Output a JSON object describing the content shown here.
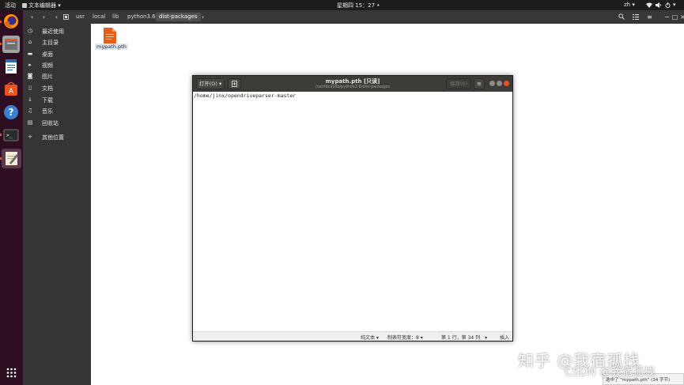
{
  "topbar": {
    "activities": "活动",
    "app_menu": "文本编辑器",
    "clock": "星期四 15：27",
    "lang": "zh"
  },
  "nautilus": {
    "path": [
      "usr",
      "local",
      "lib",
      "python3.6",
      "dist-packages"
    ],
    "sidebar": [
      {
        "icon": "clock-icon",
        "label": "最近使用"
      },
      {
        "icon": "home-icon",
        "label": "主目录"
      },
      {
        "icon": "folder-icon",
        "label": "桌面"
      },
      {
        "icon": "video-icon",
        "label": "视频"
      },
      {
        "icon": "camera-icon",
        "label": "图片"
      },
      {
        "icon": "document-icon",
        "label": "文档"
      },
      {
        "icon": "download-icon",
        "label": "下载"
      },
      {
        "icon": "music-icon",
        "label": "音乐"
      },
      {
        "icon": "trash-icon",
        "label": "回收站"
      },
      {
        "icon": "plus-icon",
        "label": "其他位置"
      }
    ],
    "file": {
      "name": "mypath.pth",
      "icon": "text-file-icon",
      "color": "#e2601b"
    },
    "status": "选中了 \"mypath.pth\" (34 字节)"
  },
  "gedit": {
    "open_label": "打开(O)",
    "title": "mypath.pth [只读]",
    "subtitle": "/usr/local/lib/python3.6/dist-packages",
    "save_label": "保存(S)",
    "content": "/home/jinx/opendriveparser-master",
    "status": {
      "syntax": "纯文本",
      "tab_width": "制表符宽度：8",
      "position": "第 1 行，第 34 列",
      "mode": "插入"
    }
  },
  "watermark": {
    "line1": "知乎 @我宿孤栈",
    "line2": "CSDN @我宿孤栈"
  },
  "colors": {
    "dock": "#2e0f22",
    "accent": "#e95420",
    "titlebar": "#3c3b37",
    "sidebar": "#353535"
  }
}
